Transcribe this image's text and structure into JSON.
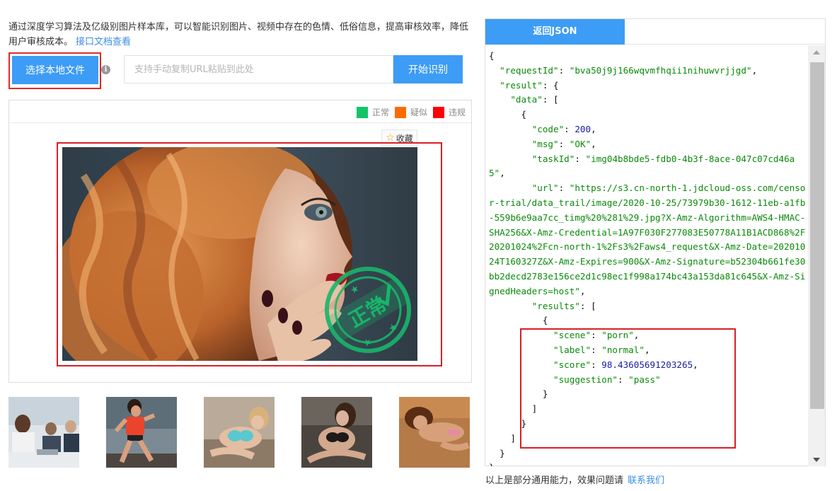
{
  "intro": {
    "text": "通过深度学习算法及亿级别图片样本库，可以智能识别图片、视频中存在的色情、低俗信息，提高审核效率，降低用户审核成本。",
    "link": "接口文档查看"
  },
  "upload": {
    "select_button": "选择本地文件",
    "info_icon": "i",
    "url_placeholder": "支持手动复制URL粘贴到此处",
    "start_button": "开始识别"
  },
  "legend": {
    "items": [
      {
        "label": "正常",
        "color": "#13c46a"
      },
      {
        "label": "疑似",
        "color": "#ff6a00"
      },
      {
        "label": "违规",
        "color": "#ff0000"
      }
    ]
  },
  "preview": {
    "favorite_label": "收藏",
    "stamp_text": "正常"
  },
  "thumbnails": [
    "office-meeting-thumb",
    "running-woman-thumb",
    "lingerie-woman-thumb",
    "lace-lingerie-thumb",
    "sand-woman-thumb"
  ],
  "json_panel": {
    "tab_label": "返回JSON"
  },
  "response": {
    "requestId": "bva50j9j166wqvmfhqii1nihuwvrjjgd",
    "code": "200",
    "msg": "OK",
    "taskId": "img04b8bde5-fdb0-4b3f-8ace-047c07cd46a5",
    "url": "https://s3.cn-north-1.jdcloud-oss.com/censor-trial/data_trail/image/2020-10-25/73979b30-1612-11eb-a1fb-559b6e9aa7cc_timg%20%281%29.jpg?X-Amz-Algorithm=AWS4-HMAC-SHA256&X-Amz-Credential=1A97F030F277083E50778A11B1ACD868%2F20201024%2Fcn-north-1%2Fs3%2Faws4_request&X-Amz-Date=20201024T160327Z&X-Amz-Expires=900&X-Amz-Signature=b52304b661fe30bb2decd2783e156ce2d1c98ec1f998a174bc43a153da81c645&X-Amz-SignedHeaders=host",
    "scene": "porn",
    "label": "normal",
    "score": "98.43605691203265",
    "suggestion": "pass"
  },
  "footer": {
    "text": "以上是部分通用能力，效果问题请",
    "link": "联系我们"
  }
}
